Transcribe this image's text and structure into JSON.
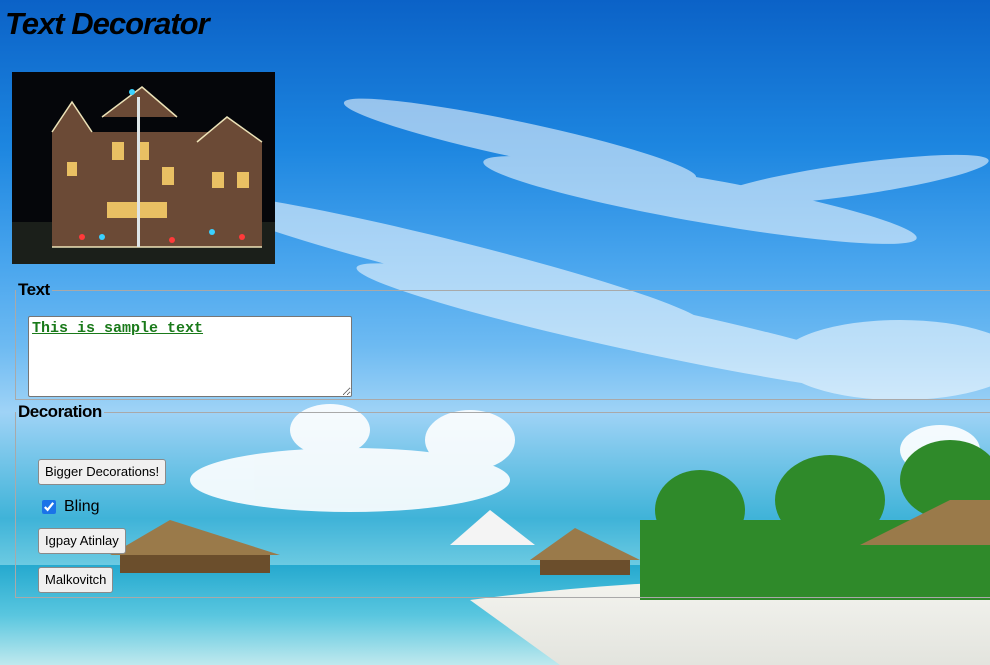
{
  "page": {
    "title": "Text Decorator"
  },
  "text_section": {
    "legend": "Text",
    "textarea_value": "This is sample text"
  },
  "decoration_section": {
    "legend": "Decoration",
    "bigger_button": "Bigger Decorations!",
    "bling_label": "Bling",
    "bling_checked": true,
    "igpay_button": "Igpay Atinlay",
    "malkovitch_button": "Malkovitch"
  },
  "colors": {
    "text_color": "#1a7a1a"
  }
}
